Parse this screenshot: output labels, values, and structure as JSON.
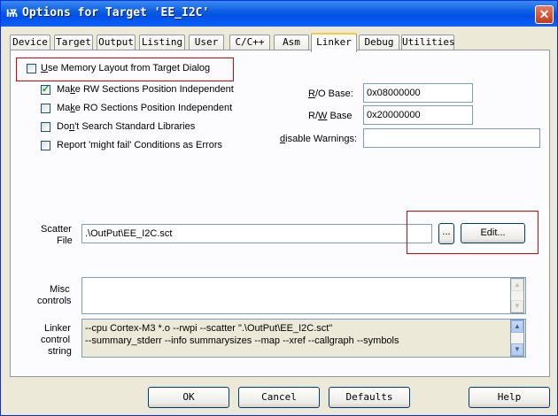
{
  "window": {
    "title": "Options for Target 'EE_I2C'",
    "close": "✕",
    "icon": "Ѭ"
  },
  "tabs": [
    "Device",
    "Target",
    "Output",
    "Listing",
    "User",
    "C/C++",
    "Asm",
    "Linker",
    "Debug",
    "Utilities"
  ],
  "options": {
    "use_memory_layout": {
      "pre": "",
      "u": "U",
      "post": "se Memory Layout from Target Dialog",
      "checked": false
    },
    "rw_independent": {
      "pre": "Ma",
      "u": "k",
      "post": "e RW Sections Position Independent",
      "checked": true
    },
    "ro_independent": {
      "pre": "Ma",
      "u": "k",
      "post": "e RO Sections Position Independent",
      "checked": false
    },
    "no_std_libs": {
      "pre": "Do",
      "u": "n",
      "post": "'t Search Standard Libraries",
      "checked": false
    },
    "might_fail_errors": {
      "pre": "Report 'might fail' Conditions as Errors",
      "u": "",
      "post": "",
      "checked": false
    }
  },
  "ro_base": {
    "label_u": "R",
    "label_rest": "/O Base:",
    "value": "0x08000000"
  },
  "rw_base": {
    "label_pre": "R/",
    "label_u": "W",
    "label_rest": " Base",
    "value": "0x20000000"
  },
  "disable_warnings": {
    "label_u": "d",
    "label_rest": "isable Warnings:",
    "value": ""
  },
  "scatter": {
    "label1": "Scatter",
    "label2": "File",
    "value": ".\\OutPut\\EE_I2C.sct",
    "browse": "...",
    "edit": "Edit..."
  },
  "misc": {
    "label1": "Misc",
    "label2": "controls",
    "value": ""
  },
  "linker": {
    "label1": "Linker",
    "label2": "control",
    "label3": "string",
    "line1": "--cpu Cortex-M3 *.o --rwpi --scatter \".\\OutPut\\EE_I2C.sct\"",
    "line2": "--summary_stderr --info summarysizes --map --xref --callgraph --symbols"
  },
  "buttons": {
    "ok": "OK",
    "cancel": "Cancel",
    "defaults": "Defaults",
    "help": "Help"
  }
}
